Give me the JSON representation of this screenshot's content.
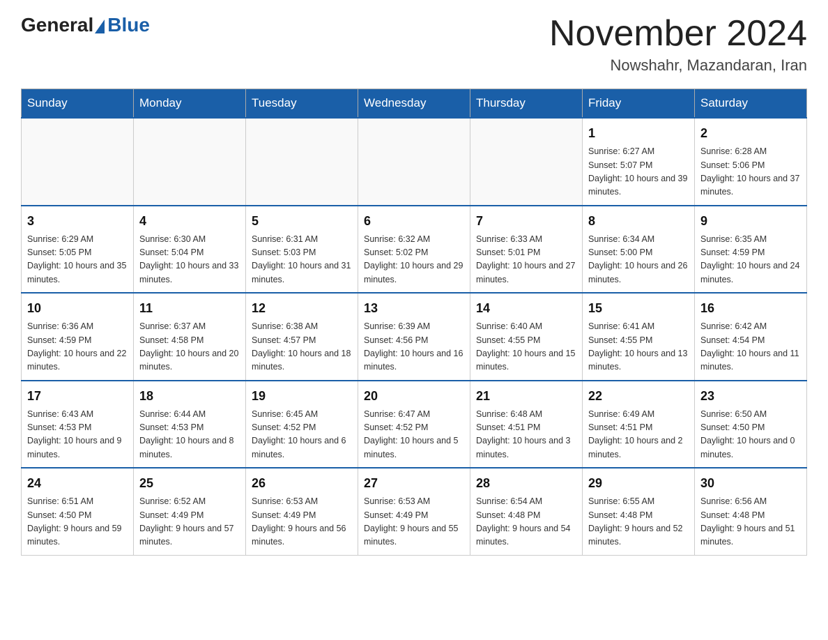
{
  "header": {
    "logo_general": "General",
    "logo_blue": "Blue",
    "month_title": "November 2024",
    "location": "Nowshahr, Mazandaran, Iran"
  },
  "days_of_week": [
    "Sunday",
    "Monday",
    "Tuesday",
    "Wednesday",
    "Thursday",
    "Friday",
    "Saturday"
  ],
  "weeks": [
    [
      {
        "day": "",
        "info": ""
      },
      {
        "day": "",
        "info": ""
      },
      {
        "day": "",
        "info": ""
      },
      {
        "day": "",
        "info": ""
      },
      {
        "day": "",
        "info": ""
      },
      {
        "day": "1",
        "info": "Sunrise: 6:27 AM\nSunset: 5:07 PM\nDaylight: 10 hours and 39 minutes."
      },
      {
        "day": "2",
        "info": "Sunrise: 6:28 AM\nSunset: 5:06 PM\nDaylight: 10 hours and 37 minutes."
      }
    ],
    [
      {
        "day": "3",
        "info": "Sunrise: 6:29 AM\nSunset: 5:05 PM\nDaylight: 10 hours and 35 minutes."
      },
      {
        "day": "4",
        "info": "Sunrise: 6:30 AM\nSunset: 5:04 PM\nDaylight: 10 hours and 33 minutes."
      },
      {
        "day": "5",
        "info": "Sunrise: 6:31 AM\nSunset: 5:03 PM\nDaylight: 10 hours and 31 minutes."
      },
      {
        "day": "6",
        "info": "Sunrise: 6:32 AM\nSunset: 5:02 PM\nDaylight: 10 hours and 29 minutes."
      },
      {
        "day": "7",
        "info": "Sunrise: 6:33 AM\nSunset: 5:01 PM\nDaylight: 10 hours and 27 minutes."
      },
      {
        "day": "8",
        "info": "Sunrise: 6:34 AM\nSunset: 5:00 PM\nDaylight: 10 hours and 26 minutes."
      },
      {
        "day": "9",
        "info": "Sunrise: 6:35 AM\nSunset: 4:59 PM\nDaylight: 10 hours and 24 minutes."
      }
    ],
    [
      {
        "day": "10",
        "info": "Sunrise: 6:36 AM\nSunset: 4:59 PM\nDaylight: 10 hours and 22 minutes."
      },
      {
        "day": "11",
        "info": "Sunrise: 6:37 AM\nSunset: 4:58 PM\nDaylight: 10 hours and 20 minutes."
      },
      {
        "day": "12",
        "info": "Sunrise: 6:38 AM\nSunset: 4:57 PM\nDaylight: 10 hours and 18 minutes."
      },
      {
        "day": "13",
        "info": "Sunrise: 6:39 AM\nSunset: 4:56 PM\nDaylight: 10 hours and 16 minutes."
      },
      {
        "day": "14",
        "info": "Sunrise: 6:40 AM\nSunset: 4:55 PM\nDaylight: 10 hours and 15 minutes."
      },
      {
        "day": "15",
        "info": "Sunrise: 6:41 AM\nSunset: 4:55 PM\nDaylight: 10 hours and 13 minutes."
      },
      {
        "day": "16",
        "info": "Sunrise: 6:42 AM\nSunset: 4:54 PM\nDaylight: 10 hours and 11 minutes."
      }
    ],
    [
      {
        "day": "17",
        "info": "Sunrise: 6:43 AM\nSunset: 4:53 PM\nDaylight: 10 hours and 9 minutes."
      },
      {
        "day": "18",
        "info": "Sunrise: 6:44 AM\nSunset: 4:53 PM\nDaylight: 10 hours and 8 minutes."
      },
      {
        "day": "19",
        "info": "Sunrise: 6:45 AM\nSunset: 4:52 PM\nDaylight: 10 hours and 6 minutes."
      },
      {
        "day": "20",
        "info": "Sunrise: 6:47 AM\nSunset: 4:52 PM\nDaylight: 10 hours and 5 minutes."
      },
      {
        "day": "21",
        "info": "Sunrise: 6:48 AM\nSunset: 4:51 PM\nDaylight: 10 hours and 3 minutes."
      },
      {
        "day": "22",
        "info": "Sunrise: 6:49 AM\nSunset: 4:51 PM\nDaylight: 10 hours and 2 minutes."
      },
      {
        "day": "23",
        "info": "Sunrise: 6:50 AM\nSunset: 4:50 PM\nDaylight: 10 hours and 0 minutes."
      }
    ],
    [
      {
        "day": "24",
        "info": "Sunrise: 6:51 AM\nSunset: 4:50 PM\nDaylight: 9 hours and 59 minutes."
      },
      {
        "day": "25",
        "info": "Sunrise: 6:52 AM\nSunset: 4:49 PM\nDaylight: 9 hours and 57 minutes."
      },
      {
        "day": "26",
        "info": "Sunrise: 6:53 AM\nSunset: 4:49 PM\nDaylight: 9 hours and 56 minutes."
      },
      {
        "day": "27",
        "info": "Sunrise: 6:53 AM\nSunset: 4:49 PM\nDaylight: 9 hours and 55 minutes."
      },
      {
        "day": "28",
        "info": "Sunrise: 6:54 AM\nSunset: 4:48 PM\nDaylight: 9 hours and 54 minutes."
      },
      {
        "day": "29",
        "info": "Sunrise: 6:55 AM\nSunset: 4:48 PM\nDaylight: 9 hours and 52 minutes."
      },
      {
        "day": "30",
        "info": "Sunrise: 6:56 AM\nSunset: 4:48 PM\nDaylight: 9 hours and 51 minutes."
      }
    ]
  ]
}
